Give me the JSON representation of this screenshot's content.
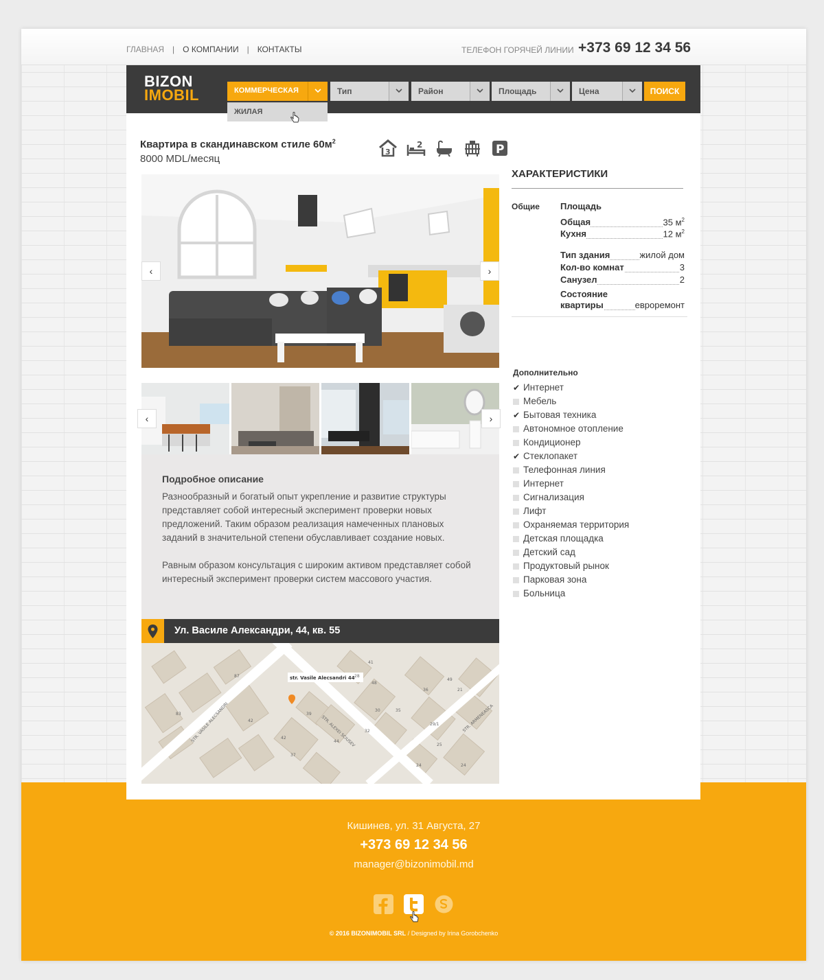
{
  "topnav": {
    "home": "ГЛАВНАЯ",
    "about": "О КОМПАНИИ",
    "contacts": "КОНТАКТЫ",
    "sep": "|"
  },
  "hotline": {
    "label": "ТЕЛЕФОН ГОРЯЧЕЙ ЛИНИИ",
    "phone": "+373 69 12 34 56"
  },
  "logo": {
    "line1": "BIZON",
    "line2": "IMOBIL"
  },
  "filters": {
    "category": "КОММЕРЧЕСКАЯ",
    "category_option": "ЖИЛАЯ",
    "type": "Тип",
    "district": "Район",
    "area": "Площадь",
    "price": "Цена",
    "search": "ПОИСК"
  },
  "listing": {
    "title": "Квартира в скандинавском стиле 60м",
    "title_sup": "2",
    "price": "8000 MDL/месяц",
    "icons": [
      "rooms-icon",
      "bedroom-icon",
      "bathtub-icon",
      "furniture-icon",
      "parking-icon"
    ],
    "rooms_badge": "3",
    "bedroom_badge": "2",
    "parking_letter": "P"
  },
  "slider": {
    "prev": "‹",
    "next": "›"
  },
  "description": {
    "title": "Подробное описание",
    "p1": "Разнообразный и богатый опыт укрепление и развитие структуры представляет собой интересный эксперимент проверки новых предложений. Таким образом реализация намеченных плановых заданий в значительной степени обуславливает создание новых.",
    "p2": "Равным образом консультация с широким активом представляет собой интересный эксперимент проверки систем массового участия."
  },
  "address": "Ул. Василе Александри, 44, кв. 55",
  "map": {
    "marker_label": "str. Vasile Alecsandri 44",
    "streets": [
      "STR. VASILE ALECSANDRI",
      "STR. ALEXEI SCIUSEV",
      "STR. ARMENEASCA"
    ],
    "numbers": [
      "83",
      "87",
      "42",
      "42",
      "39",
      "37",
      "30",
      "29/1",
      "21",
      "24",
      "24",
      "28",
      "48",
      "49",
      "25",
      "32",
      "35",
      "44",
      "36",
      "41"
    ]
  },
  "specs": {
    "title": "ХАРАКТЕРИСТИКИ",
    "group": "Общие",
    "area_heading": "Площадь",
    "total_label": "Общая",
    "total_value": "35 м",
    "total_sup": "2",
    "kitchen_label": "Кухня",
    "kitchen_value": "12 м",
    "kitchen_sup": "2",
    "building_label": "Тип здания",
    "building_value": "жилой дом",
    "rooms_label": "Кол-во комнат",
    "rooms_value": "3",
    "bath_label": "Санузел",
    "bath_value": "2",
    "state_label_1": "Состояние",
    "state_label_2": "квартиры",
    "state_value": "евроремонт"
  },
  "additional": {
    "title": "Дополнительно",
    "items": [
      {
        "label": "Интернет",
        "checked": true
      },
      {
        "label": "Мебель",
        "checked": false
      },
      {
        "label": "Бытовая техника",
        "checked": true
      },
      {
        "label": "Автономное отопление",
        "checked": false
      },
      {
        "label": "Кондиционер",
        "checked": false
      },
      {
        "label": "Стеклопакет",
        "checked": true
      },
      {
        "label": "Телефонная линия",
        "checked": false
      },
      {
        "label": "Интернет",
        "checked": false
      },
      {
        "label": "Сигнализация",
        "checked": false
      },
      {
        "label": "Лифт",
        "checked": false
      },
      {
        "label": "Охраняемая территория",
        "checked": false
      },
      {
        "label": "Детская площадка",
        "checked": false
      },
      {
        "label": "Детский сад",
        "checked": false
      },
      {
        "label": "Продуктовый рынок",
        "checked": false
      },
      {
        "label": "Парковая зона",
        "checked": false
      },
      {
        "label": "Больница",
        "checked": false
      }
    ]
  },
  "footer": {
    "address": "Кишинев, ул. 31 Августа, 27",
    "phone": "+373 69 12 34 56",
    "email": "manager@bizonimobil.md",
    "copyright": "© 2016 BIZONIMOBIL SRL",
    "divider": "/",
    "designer": "Designed by Irina Gorobchenko"
  },
  "colors": {
    "accent": "#f7a80f",
    "dark": "#3b3b3b",
    "panel": "#eae8e8"
  }
}
